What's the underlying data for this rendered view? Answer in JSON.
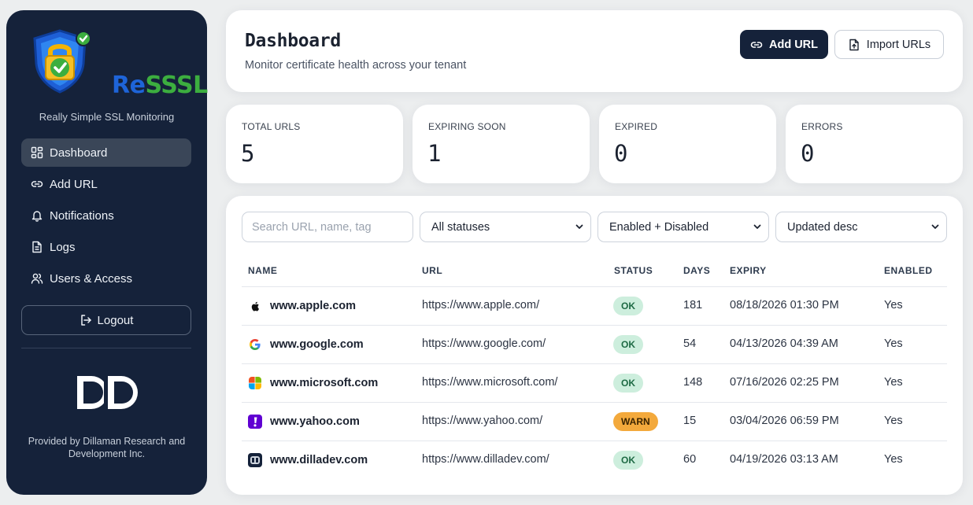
{
  "app": {
    "brand_name_a": "Re",
    "brand_name_b": "SSSL",
    "tagline": "Really Simple SSL Monitoring",
    "provided_by": "Provided by Dillaman Research and Development Inc."
  },
  "sidebar": {
    "items": [
      {
        "label": "Dashboard",
        "icon": "dashboard-icon",
        "active": true
      },
      {
        "label": "Add URL",
        "icon": "link-icon"
      },
      {
        "label": "Notifications",
        "icon": "bell-icon"
      },
      {
        "label": "Logs",
        "icon": "document-icon"
      },
      {
        "label": "Users & Access",
        "icon": "users-icon"
      }
    ],
    "logout_label": "Logout"
  },
  "header": {
    "title": "Dashboard",
    "subtitle": "Monitor certificate health across your tenant",
    "add_url_label": "Add URL",
    "import_label": "Import URLs"
  },
  "stats": [
    {
      "label": "TOTAL URLS",
      "value": "5"
    },
    {
      "label": "EXPIRING SOON",
      "value": "1"
    },
    {
      "label": "EXPIRED",
      "value": "0"
    },
    {
      "label": "ERRORS",
      "value": "0"
    }
  ],
  "filters": {
    "search_placeholder": "Search URL, name, tag",
    "status": "All statuses",
    "enabled": "Enabled + Disabled",
    "sort": "Updated desc"
  },
  "table": {
    "columns": [
      "NAME",
      "URL",
      "STATUS",
      "DAYS",
      "EXPIRY",
      "ENABLED"
    ],
    "rows": [
      {
        "name": "www.apple.com",
        "url": "https://www.apple.com/",
        "status": "OK",
        "days": "181",
        "expiry": "08/18/2026 01:30 PM",
        "enabled": "Yes",
        "icon": "apple-icon"
      },
      {
        "name": "www.google.com",
        "url": "https://www.google.com/",
        "status": "OK",
        "days": "54",
        "expiry": "04/13/2026 04:39 AM",
        "enabled": "Yes",
        "icon": "google-icon"
      },
      {
        "name": "www.microsoft.com",
        "url": "https://www.microsoft.com/",
        "status": "OK",
        "days": "148",
        "expiry": "07/16/2026 02:25 PM",
        "enabled": "Yes",
        "icon": "microsoft-icon"
      },
      {
        "name": "www.yahoo.com",
        "url": "https://www.yahoo.com/",
        "status": "WARN",
        "days": "15",
        "expiry": "03/04/2026 06:59 PM",
        "enabled": "Yes",
        "icon": "yahoo-icon"
      },
      {
        "name": "www.dilladev.com",
        "url": "https://www.dilladev.com/",
        "status": "OK",
        "days": "60",
        "expiry": "04/19/2026 03:13 AM",
        "enabled": "Yes",
        "icon": "dilladev-icon"
      }
    ]
  },
  "colors": {
    "sidebar_bg": "#15223a",
    "ok_badge": "#cdeedd",
    "warn_badge": "#f3a93c",
    "brand_blue": "#1e64d8",
    "brand_green": "#3cae3f"
  }
}
